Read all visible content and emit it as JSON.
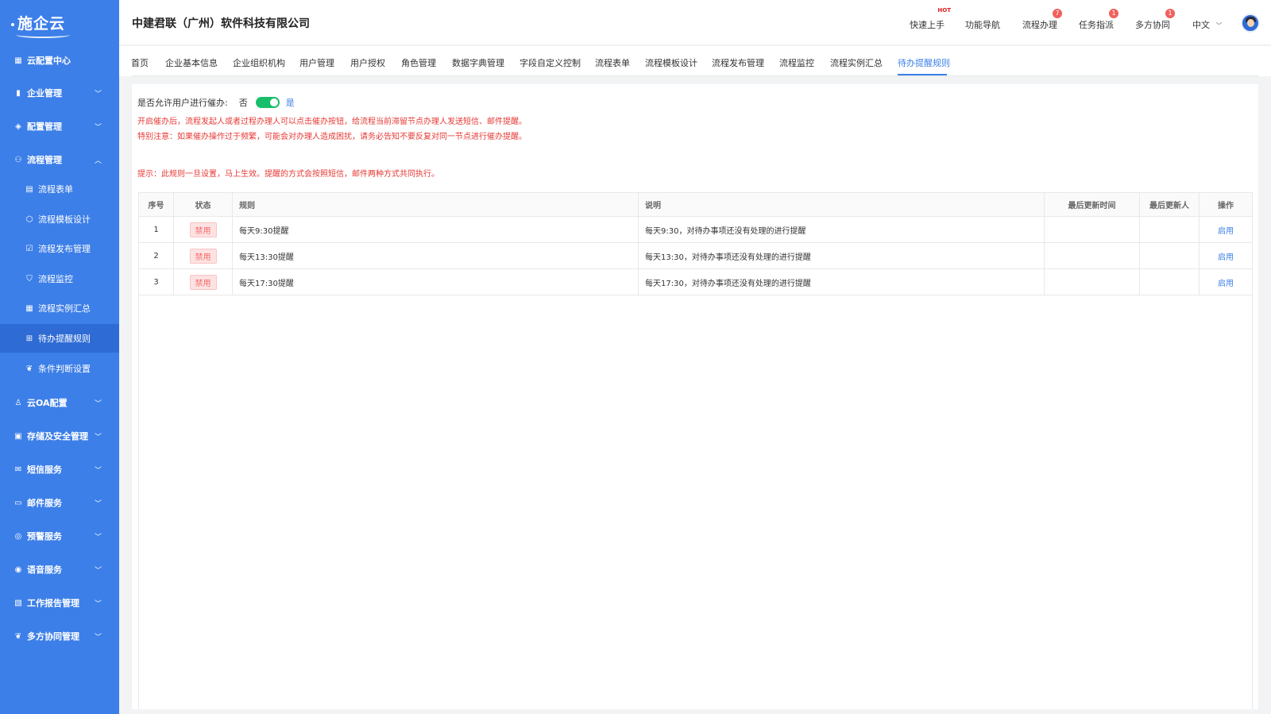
{
  "sidebar": {
    "logo": "施企云",
    "top": "云配置中心",
    "groups": [
      {
        "label": "企业管理",
        "icon": "building-icon"
      },
      {
        "label": "配置管理",
        "icon": "layers-icon"
      },
      {
        "label": "流程管理",
        "icon": "flow-icon",
        "expanded": true
      }
    ],
    "sub_items": [
      {
        "label": "流程表单",
        "icon": "form-icon"
      },
      {
        "label": "流程模板设计",
        "icon": "cube-icon"
      },
      {
        "label": "流程发布管理",
        "icon": "clipboard-check-icon"
      },
      {
        "label": "流程监控",
        "icon": "shield-icon"
      },
      {
        "label": "流程实例汇总",
        "icon": "calendar-icon"
      },
      {
        "label": "待办提醒规则",
        "icon": "grid-icon",
        "active": true
      },
      {
        "label": "条件判断设置",
        "icon": "handshake-icon"
      }
    ],
    "groups_after": [
      {
        "label": "云OA配置",
        "icon": "user-settings-icon"
      },
      {
        "label": "存储及安全管理",
        "icon": "storage-icon"
      },
      {
        "label": "短信服务",
        "icon": "mail-icon"
      },
      {
        "label": "邮件服务",
        "icon": "inbox-icon"
      },
      {
        "label": "预警服务",
        "icon": "alert-icon"
      },
      {
        "label": "语音服务",
        "icon": "voice-icon"
      },
      {
        "label": "工作报告管理",
        "icon": "report-icon"
      },
      {
        "label": "多方协同管理",
        "icon": "handshake-icon"
      }
    ]
  },
  "header": {
    "company": "中建君联（广州）软件科技有限公司",
    "quick_start": "快速上手",
    "hot": "HOT",
    "func_nav": "功能导航",
    "process": "流程办理",
    "process_badge": "7",
    "task": "任务指派",
    "task_badge": "1",
    "collab": "多方协同",
    "collab_badge": "1",
    "lang": "中文"
  },
  "tabs": [
    "首页",
    "企业基本信息",
    "企业组织机构",
    "用户管理",
    "用户授权",
    "角色管理",
    "数据字典管理",
    "字段自定义控制",
    "流程表单",
    "流程模板设计",
    "流程发布管理",
    "流程监控",
    "流程实例汇总",
    "待办提醒规则"
  ],
  "active_tab": "待办提醒规则",
  "settings": {
    "allow_label": "是否允许用户进行催办:",
    "off_label": "否",
    "on_label": "是",
    "toggle_on": true,
    "note1": "开启催办后，流程发起人或者过程办理人可以点击催办按钮，给流程当前滞留节点办理人发送短信、邮件提醒。",
    "note2": "特别注意：如果催办操作过于频繁，可能会对办理人造成困扰，请务必告知不要反复对同一节点进行催办提醒。",
    "tip": "提示：此规则一旦设置，马上生效。提醒的方式会按照短信，邮件两种方式共同执行。"
  },
  "table": {
    "headers": {
      "no": "序号",
      "status": "状态",
      "rule": "规则",
      "desc": "说明",
      "updated_time": "最后更新时间",
      "updated_by": "最后更新人",
      "op": "操作"
    },
    "rows": [
      {
        "no": "1",
        "status": "禁用",
        "rule": "每天9:30提醒",
        "desc": "每天9:30，对待办事项还没有处理的进行提醒",
        "updated_time": "",
        "updated_by": "",
        "op": "启用"
      },
      {
        "no": "2",
        "status": "禁用",
        "rule": "每天13:30提醒",
        "desc": "每天13:30，对待办事项还没有处理的进行提醒",
        "updated_time": "",
        "updated_by": "",
        "op": "启用"
      },
      {
        "no": "3",
        "status": "禁用",
        "rule": "每天17:30提醒",
        "desc": "每天17:30，对待办事项还没有处理的进行提醒",
        "updated_time": "",
        "updated_by": "",
        "op": "启用"
      }
    ]
  },
  "colors": {
    "primary": "#3d7fe8",
    "danger": "#e53935",
    "toggle": "#19be6b"
  }
}
